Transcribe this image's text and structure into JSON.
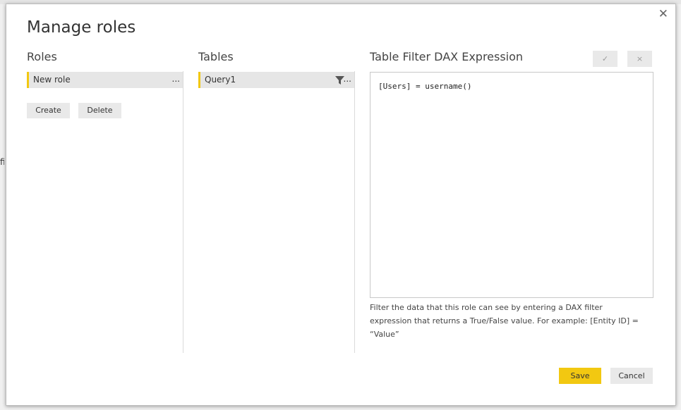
{
  "background": {
    "partial_text": "fic"
  },
  "dialog": {
    "title": "Manage roles",
    "close_glyph": "✕",
    "roles": {
      "heading": "Roles",
      "items": [
        {
          "label": "New role",
          "more": "..."
        }
      ],
      "create_label": "Create",
      "delete_label": "Delete"
    },
    "tables": {
      "heading": "Tables",
      "items": [
        {
          "label": "Query1",
          "more": "...",
          "icon": "filter-icon"
        }
      ]
    },
    "dax": {
      "heading": "Table Filter DAX Expression",
      "accept_glyph": "✓",
      "cancel_glyph": "×",
      "expression": "[Users] = username()",
      "hint": "Filter the data that this role can see by entering a DAX filter expression that returns a True/False value. For example: [Entity ID] = “Value”"
    },
    "footer": {
      "save_label": "Save",
      "cancel_label": "Cancel"
    }
  },
  "colors": {
    "accent": "#f2c811",
    "selected_bg": "#e6e6e6"
  }
}
